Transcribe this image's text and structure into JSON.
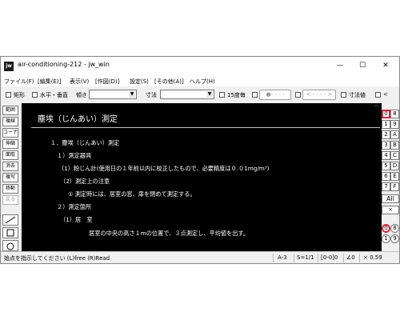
{
  "window": {
    "app_icon": "jw",
    "title": "air-conditioning-212 - jw_win",
    "minimize": "—",
    "maximize": "☐",
    "close": "✕"
  },
  "menu": [
    "ファイル(F)",
    "[編集(E)]",
    "表示(V)",
    "[作図(D)]",
    "設定(S)",
    "[その他(A)]",
    "ヘルプ(H)"
  ],
  "toolbar": {
    "rect_label": "矩形",
    "hv_label": "水平・垂直",
    "slope_label": "傾き",
    "dim_label": "寸法",
    "deg15_label": "15度毎",
    "pill1": "●- - - -",
    "pill2": "< - - - - >",
    "dimval_label": "寸法値",
    "last_label": "<"
  },
  "left_buttons": [
    "範囲",
    "複線",
    "コーナー",
    "伸縮",
    "面取",
    "消去",
    "複写",
    "移動",
    "戻る"
  ],
  "right_buttons": [
    "0",
    "8",
    "1",
    "9",
    "2",
    "A",
    "3",
    "B",
    "4",
    "C",
    "5",
    "D",
    "6",
    "E",
    "7",
    "F"
  ],
  "right_extra": [
    "All",
    "×",
    "0",
    "8",
    "1",
    "9"
  ],
  "drawing": {
    "title": "塵埃（じんあい）測定",
    "lines": [
      "１．塵埃（じんあい）測定",
      "１）測定器具",
      "（1）粉じん計(使用日の１年前以内に校正したもので、必要精度は０.０1mg/m³)",
      "（2）測定上の注意",
      "① 測定時には、居室の窓、扉を閉めて測定する。",
      "２）測定箇所",
      "（1）居　室",
      "居室の中央の高さ１mの位置で、３点測定し、平均値を出す。"
    ]
  },
  "status": {
    "message": "始点を指示してください (L)free (R)Read",
    "paper": "A-3",
    "scale": "S=1/1",
    "layer": "[0-0]0",
    "angle": "∠0",
    "zoom": "× 0.59"
  }
}
